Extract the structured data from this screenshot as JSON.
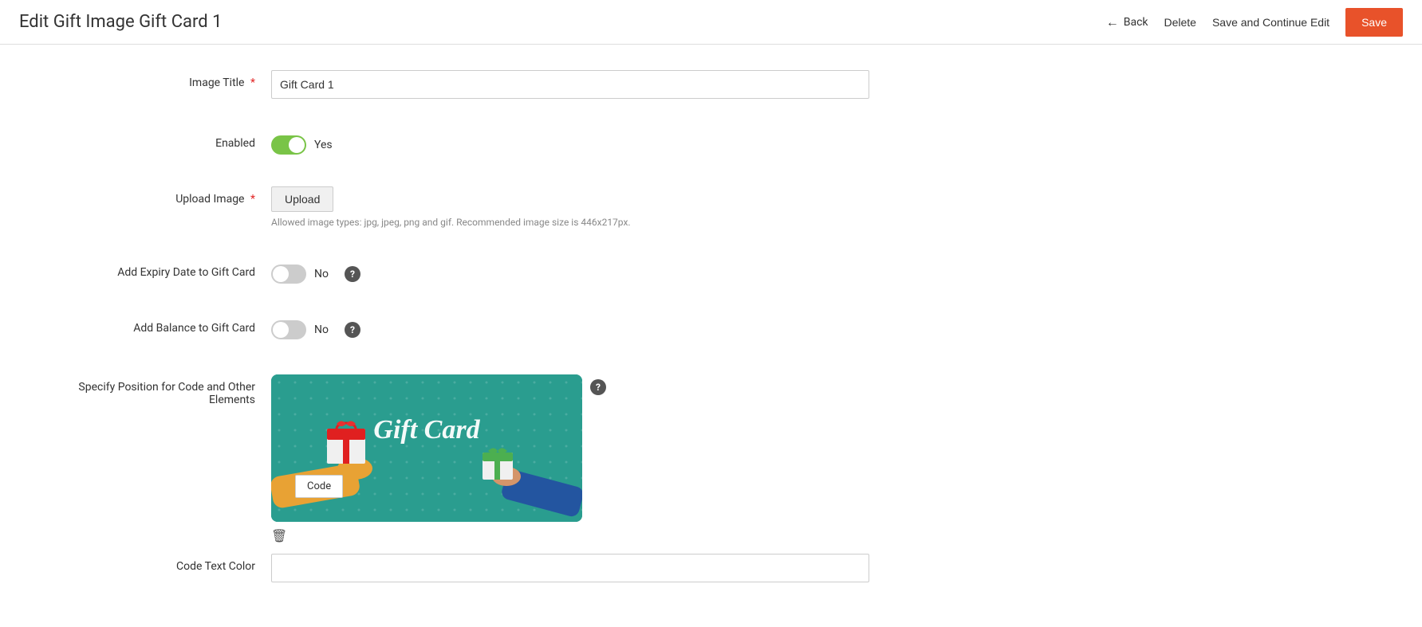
{
  "header": {
    "title": "Edit Gift Image Gift Card 1",
    "back_label": "Back",
    "delete_label": "Delete",
    "save_continue_label": "Save and Continue Edit",
    "save_label": "Save"
  },
  "form": {
    "image_title_label": "Image Title",
    "image_title_value": "Gift Card 1",
    "image_title_required": true,
    "enabled_label": "Enabled",
    "enabled_value": true,
    "enabled_text": "Yes",
    "upload_image_label": "Upload Image",
    "upload_image_required": true,
    "upload_btn_label": "Upload",
    "upload_hint": "Allowed image types: jpg, jpeg, png and gif. Recommended image size is 446x217px.",
    "add_expiry_label": "Add Expiry Date to Gift Card",
    "add_expiry_value": false,
    "add_expiry_text": "No",
    "add_balance_label": "Add Balance to Gift Card",
    "add_balance_value": false,
    "add_balance_text": "No",
    "specify_position_label": "Specify Position for Code and Other Elements",
    "code_box_label": "Code",
    "code_text_color_label": "Code Text Color",
    "gift_card_text": "Gift Card"
  },
  "icons": {
    "trash": "🗑",
    "question": "?",
    "arrow_left": "←"
  }
}
